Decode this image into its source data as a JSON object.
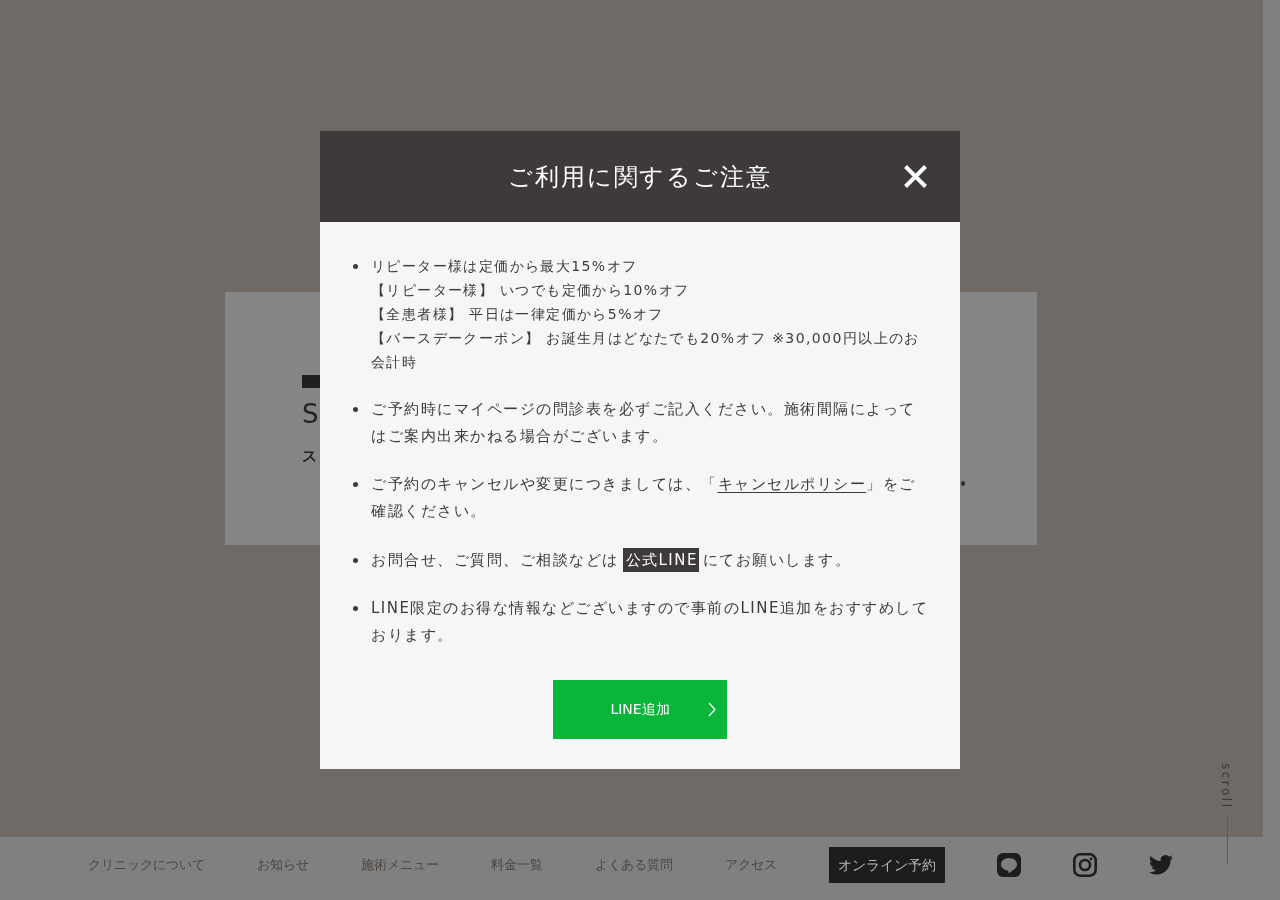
{
  "background_card": {
    "texts": [
      {
        "kind": "title",
        "text": "S"
      },
      {
        "kind": "subtitle",
        "text": "ス"
      }
    ]
  },
  "modal": {
    "title": "ご利用に関するご注意",
    "notices": [
      {
        "kind": "lines",
        "lines": [
          "リピーター様は定価から最大15%オフ",
          "【リピーター様】 いつでも定価から10%オフ",
          "【全患者様】 平日は一律定価から5%オフ",
          "【バースデークーポン】 お誕生月はどなたでも20%オフ ※30,000円以上のお会計時"
        ]
      },
      {
        "kind": "text",
        "parts": [
          {
            "kind": "text",
            "text": "ご予約時にマイページの問診表を必ずご記入ください。施術間隔によってはご案内出来かねる場合がございます。"
          }
        ]
      },
      {
        "kind": "text",
        "parts": [
          {
            "kind": "text",
            "text": "ご予約のキャンセルや変更につきましては、「"
          },
          {
            "kind": "link",
            "text": "キャンセルポリシー"
          },
          {
            "kind": "text",
            "text": "」をご確認ください。"
          }
        ]
      },
      {
        "kind": "text",
        "parts": [
          {
            "kind": "text",
            "text": "お問合せ、ご質問、ご相談などは"
          },
          {
            "kind": "tag",
            "text": "公式LINE"
          },
          {
            "kind": "text",
            "text": "にてお願いします。"
          }
        ]
      },
      {
        "kind": "text",
        "parts": [
          {
            "kind": "text",
            "text": "LINE限定のお得な情報などございますので事前のLINE追加をおすすめしております。"
          }
        ]
      }
    ],
    "button": {
      "label": "LINE追加"
    }
  },
  "footer_nav": [
    {
      "kind": "link",
      "label": "クリニックについて"
    },
    {
      "kind": "link",
      "label": "お知らせ"
    },
    {
      "kind": "link",
      "label": "施術メニュー"
    },
    {
      "kind": "link",
      "label": "料金一覧"
    },
    {
      "kind": "link",
      "label": "よくある質問"
    },
    {
      "kind": "link",
      "label": "アクセス"
    },
    {
      "kind": "button",
      "label": "オンライン予約"
    }
  ],
  "scroll_hint": {
    "label": "scroll"
  }
}
